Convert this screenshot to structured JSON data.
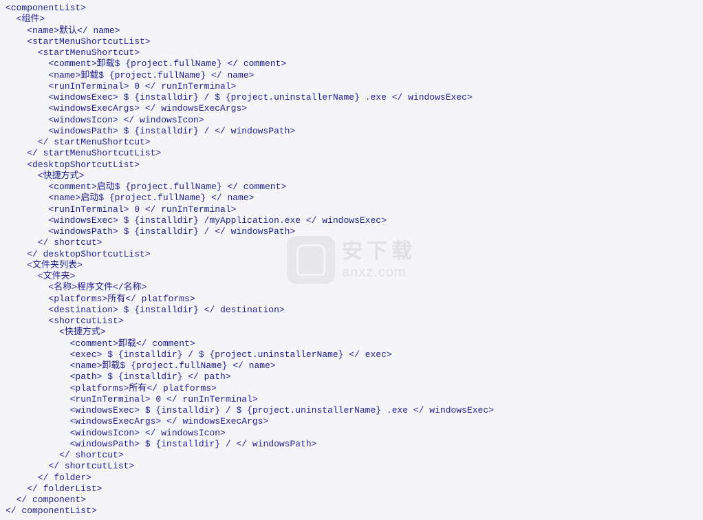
{
  "watermark": {
    "cn": "安下载",
    "en": "anxz.com"
  },
  "lines": [
    "<componentList>",
    "  <组件>",
    "    <name>默认</ name>",
    "    <startMenuShortcutList>",
    "      <startMenuShortcut>",
    "        <comment>卸载$ {project.fullName} </ comment>",
    "        <name>卸载$ {project.fullName} </ name>",
    "        <runInTerminal> 0 </ runInTerminal>",
    "        <windowsExec> $ {installdir} / $ {project.uninstallerName} .exe </ windowsExec>",
    "        <windowsExecArgs> </ windowsExecArgs>",
    "        <windowsIcon> </ windowsIcon>",
    "        <windowsPath> $ {installdir} / </ windowsPath>",
    "      </ startMenuShortcut>",
    "    </ startMenuShortcutList>",
    "    <desktopShortcutList>",
    "      <快捷方式>",
    "        <comment>启动$ {project.fullName} </ comment>",
    "        <name>启动$ {project.fullName} </ name>",
    "        <runInTerminal> 0 </ runInTerminal>",
    "        <windowsExec> $ {installdir} /myApplication.exe </ windowsExec>",
    "        <windowsPath> $ {installdir} / </ windowsPath>",
    "      </ shortcut>",
    "    </ desktopShortcutList>",
    "    <文件夹列表>",
    "      <文件夹>",
    "        <名称>程序文件</名称>",
    "        <platforms>所有</ platforms>",
    "        <destination> $ {installdir} </ destination>",
    "        <shortcutList>",
    "          <快捷方式>",
    "            <comment>卸载</ comment>",
    "            <exec> $ {installdir} / $ {project.uninstallerName} </ exec>",
    "            <name>卸载$ {project.fullName} </ name>",
    "            <path> $ {installdir} </ path>",
    "            <platforms>所有</ platforms>",
    "            <runInTerminal> 0 </ runInTerminal>",
    "            <windowsExec> $ {installdir} / $ {project.uninstallerName} .exe </ windowsExec>",
    "            <windowsExecArgs> </ windowsExecArgs>",
    "            <windowsIcon> </ windowsIcon>",
    "            <windowsPath> $ {installdir} / </ windowsPath>",
    "          </ shortcut>",
    "        </ shortcutList>",
    "      </ folder>",
    "    </ folderList>",
    "  </ component>",
    "</ componentList>"
  ]
}
